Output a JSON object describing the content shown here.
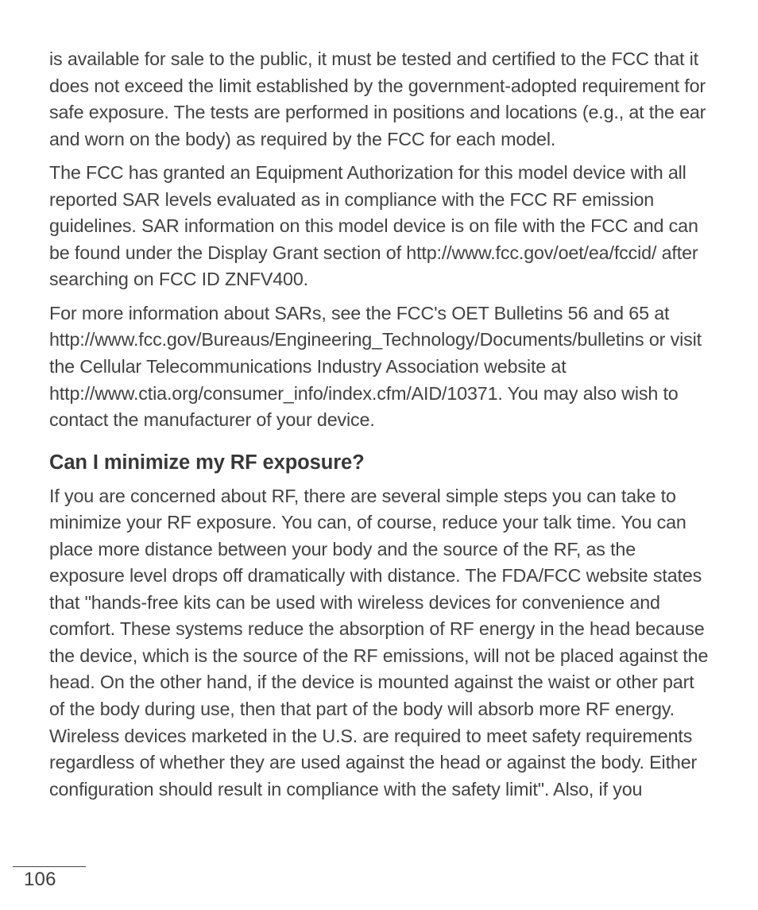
{
  "paragraphs": {
    "p1": "is available for sale to the public, it must be tested and certified to the FCC that it does not exceed the limit established by the government-adopted requirement for safe exposure. The tests are performed in positions and locations (e.g., at the ear and worn on the body) as required by the FCC for each model.",
    "p2": "The FCC has granted an Equipment Authorization for this model device with all reported SAR levels evaluated as in compliance with the FCC RF emission guidelines. SAR information on this model device is on file with the FCC and can be found under the Display Grant section of http://www.fcc.gov/oet/ea/fccid/ after searching on FCC ID ZNFV400.",
    "p3": "For more information about SARs, see the FCC's OET Bulletins 56 and 65 at http://www.fcc.gov/Bureaus/Engineering_Technology/Documents/bulletins or visit the Cellular Telecommunications Industry Association website at http://www.ctia.org/consumer_info/index.cfm/AID/10371. You may also wish to contact the manufacturer of your device."
  },
  "heading": "Can I minimize my RF exposure?",
  "paragraphs2": {
    "p4": "If you are concerned about RF, there are several simple steps you can take to minimize your RF exposure. You can, of course, reduce your talk time. You can place more distance between your body and the source of the RF, as the exposure level drops off dramatically with distance. The FDA/FCC website states that \"hands-free kits can be used with wireless devices for convenience and comfort. These systems reduce the absorption of RF energy in the head because the device, which is the source of the RF emissions, will not be placed against the head. On the other hand, if the device is mounted against the waist or other part of the body during use, then that part of the body will absorb more RF energy. Wireless devices marketed in the U.S. are required to meet safety requirements regardless of whether they are used against the head or against the body. Either configuration should result in compliance with the safety limit\". Also, if you"
  },
  "pageNumber": "106"
}
